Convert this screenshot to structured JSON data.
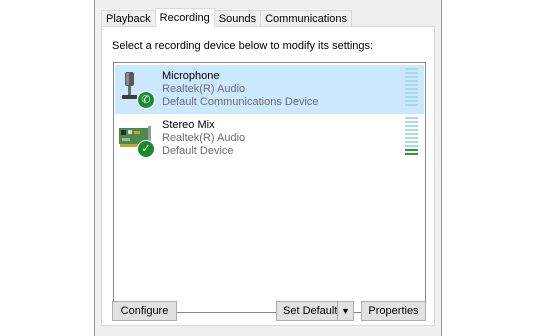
{
  "tabs": [
    {
      "label": "Playback",
      "active": false
    },
    {
      "label": "Recording",
      "active": true
    },
    {
      "label": "Sounds",
      "active": false
    },
    {
      "label": "Communications",
      "active": false
    }
  ],
  "instruction": "Select a recording device below to modify its settings:",
  "devices": [
    {
      "name": "Microphone",
      "driver": "Realtek(R) Audio",
      "status": "Default Communications Device",
      "selected": true,
      "icon": "microphone-icon",
      "badge_icon": "phone-icon"
    },
    {
      "name": "Stereo Mix",
      "driver": "Realtek(R) Audio",
      "status": "Default Device",
      "selected": false,
      "icon": "sound-card-icon",
      "badge_icon": "check-icon"
    }
  ],
  "buttons": {
    "configure": "Configure",
    "set_default": "Set Default",
    "properties": "Properties"
  },
  "colors": {
    "selection": "#cce8ff",
    "badge_green": "#1a8a2e",
    "meter_idle": "#aad9ec",
    "meter_active": "#2a9a2a"
  }
}
